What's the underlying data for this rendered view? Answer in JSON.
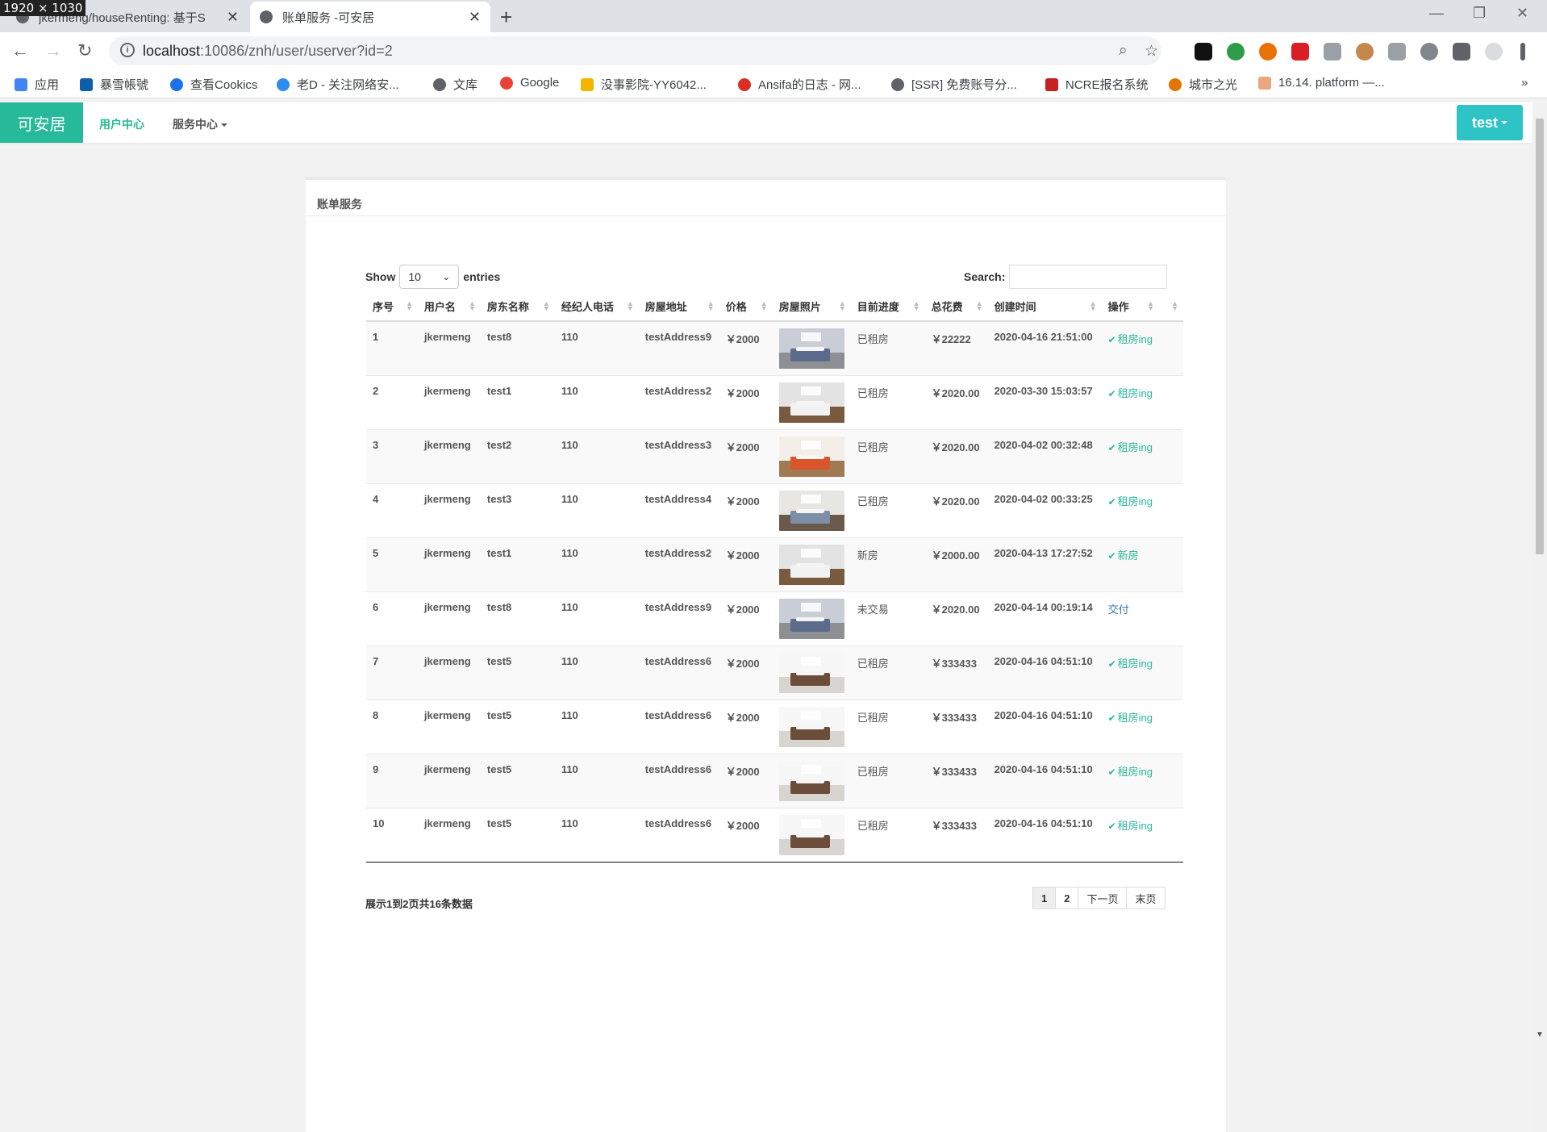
{
  "screen_badge": "1920 × 1030",
  "browser": {
    "tabs": [
      {
        "title": "jkermeng/houseRenting: 基于S",
        "active": false
      },
      {
        "title": "账单服务 -可安居",
        "active": true
      }
    ],
    "new_tab": "+",
    "url_host": "localhost",
    "url_path": ":10086/znh/user/userver?id=2",
    "bookmarks": [
      {
        "label": "应用",
        "color": "#4285f4"
      },
      {
        "label": "暴雪帳號",
        "color": "#0e5fa8"
      },
      {
        "label": "查看Cookics",
        "color": "#1a73e8"
      },
      {
        "label": "老D - 关注网络安...",
        "color": "#2d8cf0"
      },
      {
        "label": "文库",
        "color": "#5f6368"
      },
      {
        "label": "Google",
        "color": "#ea4335"
      },
      {
        "label": "没事影院-YY6042...",
        "color": "#f4b400"
      },
      {
        "label": "Ansifa的日志 - 网...",
        "color": "#d93025"
      },
      {
        "label": "[SSR] 免费账号分...",
        "color": "#5f6368"
      },
      {
        "label": "NCRE报名系统",
        "color": "#c5221f"
      },
      {
        "label": "城市之光",
        "color": "#e37400"
      },
      {
        "label": "16.14. platform —...",
        "color": "#e8a87c"
      }
    ],
    "more_bookmarks": "»"
  },
  "navbar": {
    "brand": "可安居",
    "user_center": "用户中心",
    "service_center": "服务中心",
    "user_button": "test",
    "brand_color": "#26b99a",
    "user_button_color": "#2ec4c6"
  },
  "panel": {
    "title": "账单服务",
    "show_label": "Show",
    "entries_value": "10",
    "entries_label": "entries",
    "search_label": "Search:",
    "search_value": ""
  },
  "table": {
    "headers": [
      "序号",
      "用户名",
      "房东名称",
      "经纪人电话",
      "房屋地址",
      "价格",
      "房屋照片",
      "目前进度",
      "总花费",
      "创建时间",
      "操作",
      ""
    ],
    "rows": [
      {
        "id": "1",
        "user": "jkermeng",
        "landlord": "test8",
        "phone": "110",
        "address": "testAddress9",
        "price": "￥2000",
        "photo": "bedroom-blue",
        "status": "已租房",
        "total": "￥22222",
        "created": "2020-04-16 21:51:00",
        "op": "租房ing",
        "op_check": true
      },
      {
        "id": "2",
        "user": "jkermeng",
        "landlord": "test1",
        "phone": "110",
        "address": "testAddress2",
        "price": "￥2000",
        "photo": "bedroom-white",
        "status": "已租房",
        "total": "￥2020.00",
        "created": "2020-03-30 15:03:57",
        "op": "租房ing",
        "op_check": true
      },
      {
        "id": "3",
        "user": "jkermeng",
        "landlord": "test2",
        "phone": "110",
        "address": "testAddress3",
        "price": "￥2000",
        "photo": "kitchen",
        "status": "已租房",
        "total": "￥2020.00",
        "created": "2020-04-02 00:32:48",
        "op": "租房ing",
        "op_check": true
      },
      {
        "id": "4",
        "user": "jkermeng",
        "landlord": "test3",
        "phone": "110",
        "address": "testAddress4",
        "price": "￥2000",
        "photo": "living",
        "status": "已租房",
        "total": "￥2020.00",
        "created": "2020-04-02 00:33:25",
        "op": "租房ing",
        "op_check": true
      },
      {
        "id": "5",
        "user": "jkermeng",
        "landlord": "test1",
        "phone": "110",
        "address": "testAddress2",
        "price": "￥2000",
        "photo": "bedroom-white",
        "status": "新房",
        "total": "￥2000.00",
        "created": "2020-04-13 17:27:52",
        "op": "新房",
        "op_check": true
      },
      {
        "id": "6",
        "user": "jkermeng",
        "landlord": "test8",
        "phone": "110",
        "address": "testAddress9",
        "price": "￥2000",
        "photo": "bedroom-blue",
        "status": "未交易",
        "total": "￥2020.00",
        "created": "2020-04-14 00:19:14",
        "op": "交付",
        "op_check": false
      },
      {
        "id": "7",
        "user": "jkermeng",
        "landlord": "test5",
        "phone": "110",
        "address": "testAddress6",
        "price": "￥2000",
        "photo": "bedroom-bright",
        "status": "已租房",
        "total": "￥333433",
        "created": "2020-04-16 04:51:10",
        "op": "租房ing",
        "op_check": true
      },
      {
        "id": "8",
        "user": "jkermeng",
        "landlord": "test5",
        "phone": "110",
        "address": "testAddress6",
        "price": "￥2000",
        "photo": "bedroom-bright",
        "status": "已租房",
        "total": "￥333433",
        "created": "2020-04-16 04:51:10",
        "op": "租房ing",
        "op_check": true
      },
      {
        "id": "9",
        "user": "jkermeng",
        "landlord": "test5",
        "phone": "110",
        "address": "testAddress6",
        "price": "￥2000",
        "photo": "bedroom-bright",
        "status": "已租房",
        "total": "￥333433",
        "created": "2020-04-16 04:51:10",
        "op": "租房ing",
        "op_check": true
      },
      {
        "id": "10",
        "user": "jkermeng",
        "landlord": "test5",
        "phone": "110",
        "address": "testAddress6",
        "price": "￥2000",
        "photo": "bedroom-bright",
        "status": "已租房",
        "total": "￥333433",
        "created": "2020-04-16 04:51:10",
        "op": "租房ing",
        "op_check": true
      }
    ]
  },
  "footer": {
    "info": "展示1到2页共16条数据",
    "pages": [
      "1",
      "2"
    ],
    "next": "下一页",
    "last": "末页"
  }
}
